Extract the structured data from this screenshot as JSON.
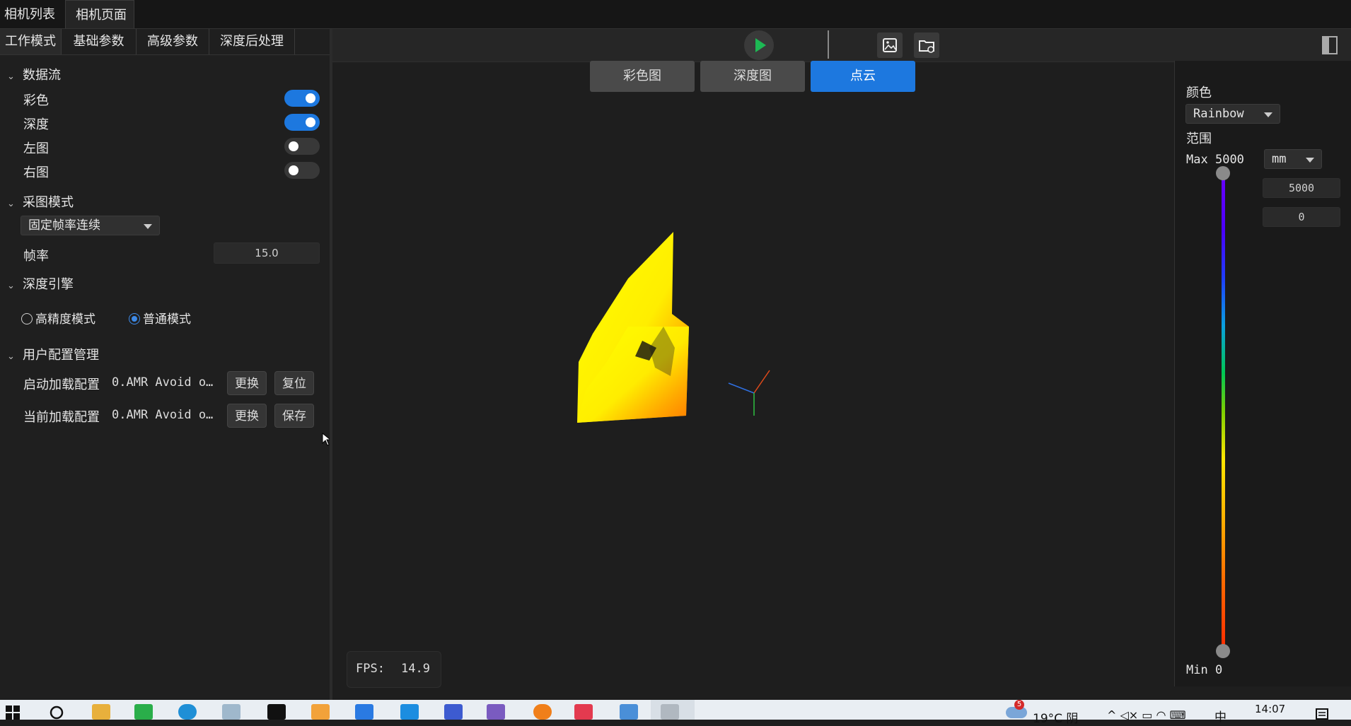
{
  "tabs": {
    "camera_list": "相机列表",
    "camera_page": "相机页面"
  },
  "subtabs": [
    "工作模式",
    "基础参数",
    "高级参数",
    "深度后处理"
  ],
  "dataflow": {
    "title": "数据流",
    "items": [
      {
        "label": "彩色",
        "on": true
      },
      {
        "label": "深度",
        "on": true
      },
      {
        "label": "左图",
        "on": false
      },
      {
        "label": "右图",
        "on": false
      }
    ]
  },
  "capture": {
    "title": "采图模式",
    "mode": "固定帧率连续",
    "fps_label": "帧率",
    "fps_value": "15.0"
  },
  "depth_engine": {
    "title": "深度引擎",
    "options": [
      "高精度模式",
      "普通模式"
    ],
    "selected": "普通模式"
  },
  "user_config": {
    "title": "用户配置管理",
    "startup_label": "启动加载配置",
    "startup_value": "0.AMR Avoid o…",
    "startup_btn1": "更换",
    "startup_btn2": "复位",
    "current_label": "当前加载配置",
    "current_value": "0.AMR Avoid o…",
    "current_btn1": "更换",
    "current_btn2": "保存"
  },
  "view_tabs": [
    "彩色图",
    "深度图",
    "点云"
  ],
  "active_view": "点云",
  "fps": {
    "label": "FPS:",
    "value": "14.9"
  },
  "color_panel": {
    "color_label": "颜色",
    "colormap": "Rainbow",
    "range_label": "范围",
    "max_label": "Max",
    "max_value": "5000",
    "unit": "mm",
    "field_max": "5000",
    "field_min": "0",
    "min_label": "Min",
    "min_value": "0"
  },
  "taskbar": {
    "weather": "19°C 阴",
    "ime": "中",
    "time": "14:07",
    "badge": "5"
  },
  "colors": {
    "accent": "#1d78df",
    "play": "#1db954"
  }
}
